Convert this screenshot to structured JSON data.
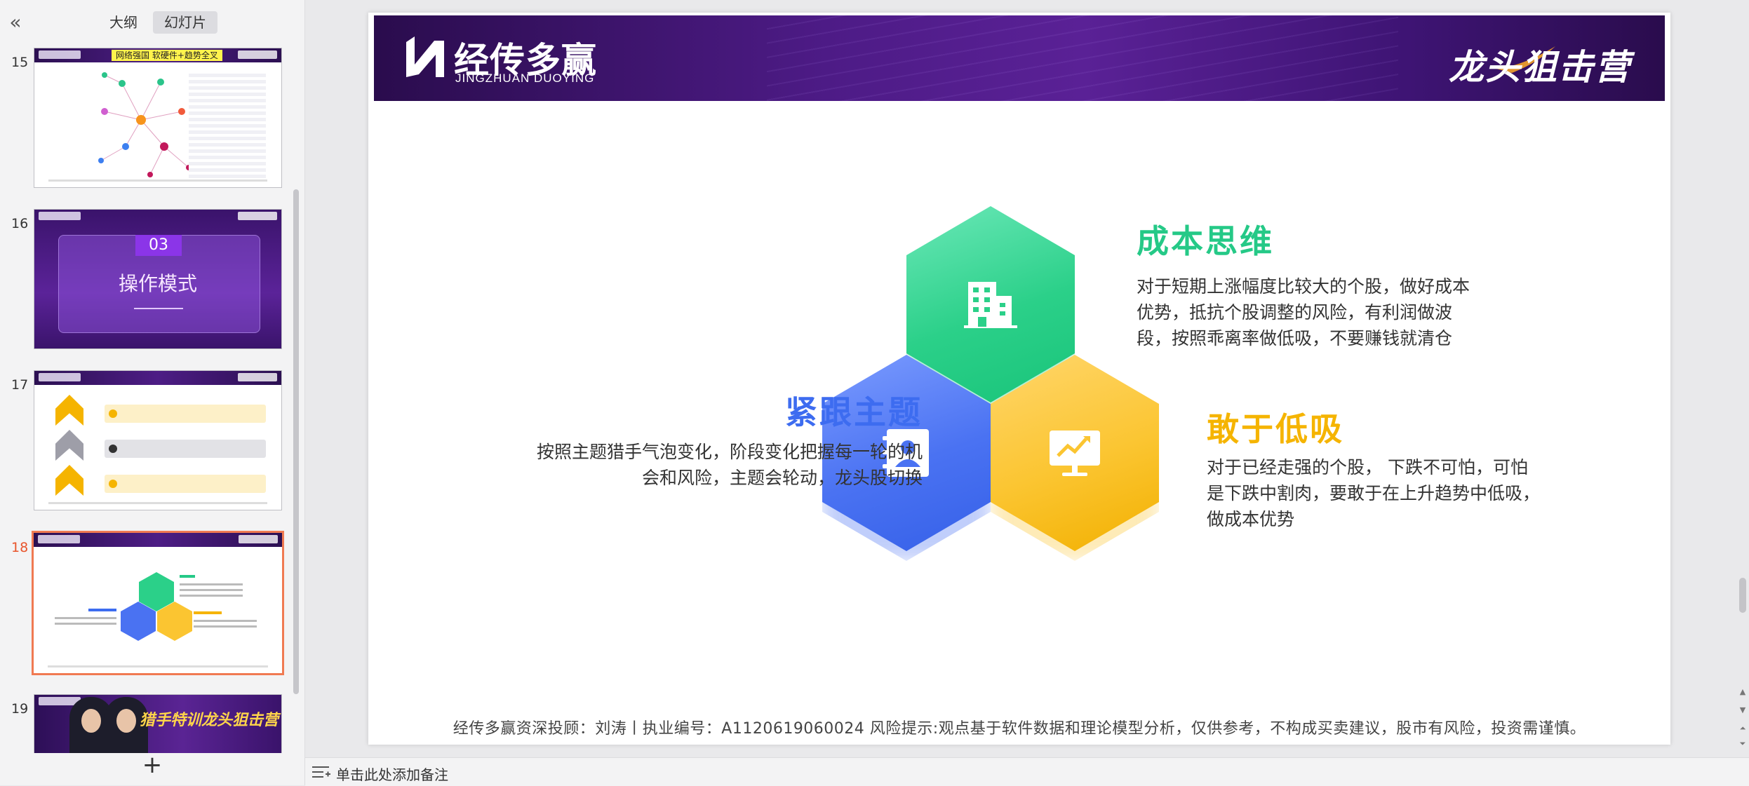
{
  "left_panel": {
    "collapse_icon": "«",
    "tabs": [
      {
        "label": "大纲",
        "active": false
      },
      {
        "label": "幻灯片",
        "active": true
      }
    ],
    "add_icon": "+"
  },
  "thumbnails": [
    {
      "number": "15",
      "title": "网络强国  软硬件+趋势全叉"
    },
    {
      "number": "16",
      "section_number": "03",
      "title": "操作模式"
    },
    {
      "number": "17"
    },
    {
      "number": "18",
      "selected": true
    },
    {
      "number": "19",
      "title": "猎手特训龙头狙击营"
    }
  ],
  "slide": {
    "logo_cn": "经传多赢",
    "logo_en": "JINGZHUAN DUOYING",
    "brand_right": "龙头狙击营",
    "sections": {
      "cost": {
        "title": "成本思维",
        "body": "对于短期上涨幅度比较大的个股，做好成本优势，抵抗个股调整的风险，有利润做波段，按照乖离率做低吸，不要赚钱就清仓",
        "color": "#25c987",
        "icon": "building-icon"
      },
      "theme": {
        "title": "紧跟主题",
        "body": "按照主题猎手气泡变化，阶段变化把握每一轮的机会和风险，主题会轮动，龙头股切换",
        "color": "#3d6cf0",
        "icon": "contact-book-icon"
      },
      "low": {
        "title": "敢于低吸",
        "body": "对于已经走强的个股， 下跌不可怕，可怕是下跌中割肉，要敢于在上升趋势中低吸，做成本优势",
        "color": "#f5b400",
        "icon": "monitor-chart-icon"
      }
    },
    "footer": "经传多赢资深投顾：刘涛丨执业编号：A1120619060024   风险提示:观点基于软件数据和理论模型分析，仅供参考，不构成买卖建议，股市有风险，投资需谨慎。"
  },
  "notes": {
    "placeholder": "单击此处添加备注"
  }
}
